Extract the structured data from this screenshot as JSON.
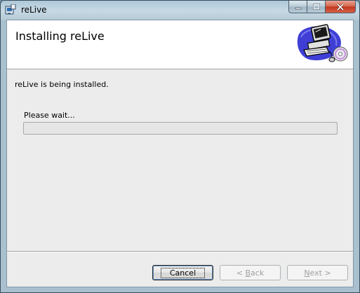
{
  "window": {
    "title": "reLive",
    "icons": {
      "app": "installer-app-icon",
      "minimize": "minimize-icon",
      "maximize": "maximize-icon",
      "close": "close-icon"
    }
  },
  "banner": {
    "title": "Installing reLive",
    "graphic": "computer-cd-icon"
  },
  "body": {
    "status": "reLive is being installed.",
    "wait_label": "Please wait...",
    "progress_fraction": 0
  },
  "buttons": {
    "cancel": "Cancel",
    "back_mnemonic": "B",
    "back_rest": "ack",
    "back_prefix": "< ",
    "next_mnemonic": "N",
    "next_rest": "ext",
    "next_suffix": " >"
  }
}
